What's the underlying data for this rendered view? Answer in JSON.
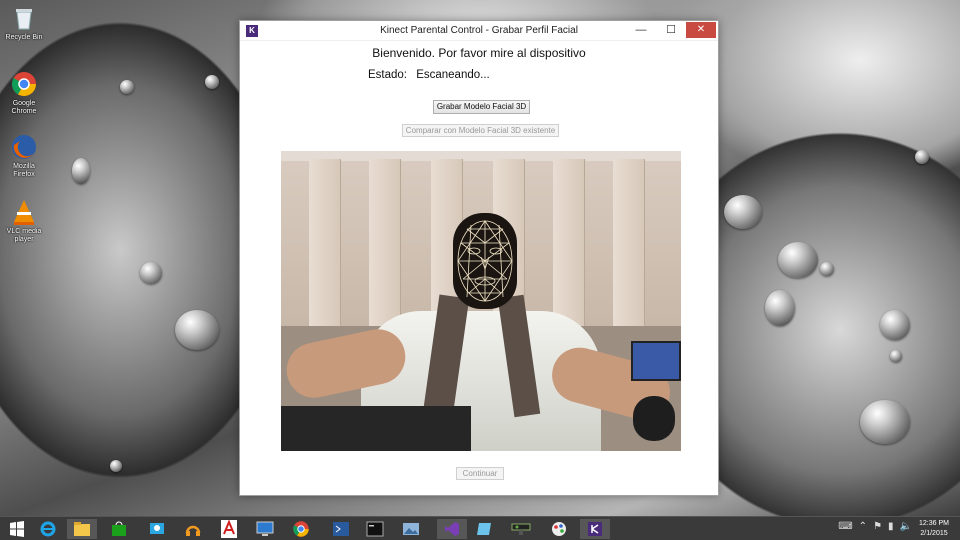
{
  "desktop": {
    "icons": [
      {
        "label": "Recycle Bin",
        "icon": "recycle-bin-icon"
      },
      {
        "label": "Google Chrome",
        "icon": "chrome-icon"
      },
      {
        "label": "Mozilla Firefox",
        "icon": "firefox-icon"
      },
      {
        "label": "VLC media player",
        "icon": "vlc-icon"
      }
    ]
  },
  "window": {
    "title": "Kinect Parental Control - Grabar Perfil Facial",
    "badge": "K",
    "controls": {
      "minimize": "—",
      "maximize": "☐",
      "close": "✕"
    },
    "welcome": "Bienvenido. Por favor mire al dispositivo",
    "status_label": "Estado:",
    "status_value": "Escaneando...",
    "record_button": "Grabar Modelo Facial 3D",
    "compare_button": "Comparar con Modelo Facial 3D existente",
    "continue_button": "Continuar"
  },
  "taskbar": {
    "items": [
      "start-icon",
      "ie-icon",
      "explorer-icon",
      "store-icon",
      "remote-icon",
      "headphones-icon",
      "adobe-icon",
      "monitor-icon",
      "chrome-icon",
      "powershell-icon",
      "cmd-icon",
      "photos-icon",
      "visual-studio-icon",
      "tablet-icon",
      "kinect-icon",
      "paint-icon",
      "kinect-app-icon"
    ],
    "clock_time": "12:36 PM",
    "clock_date": "2/1/2015"
  },
  "colors": {
    "close_button": "#c94a40",
    "taskbar": "#3a3a3a",
    "app_badge": "#4a2a7a"
  }
}
